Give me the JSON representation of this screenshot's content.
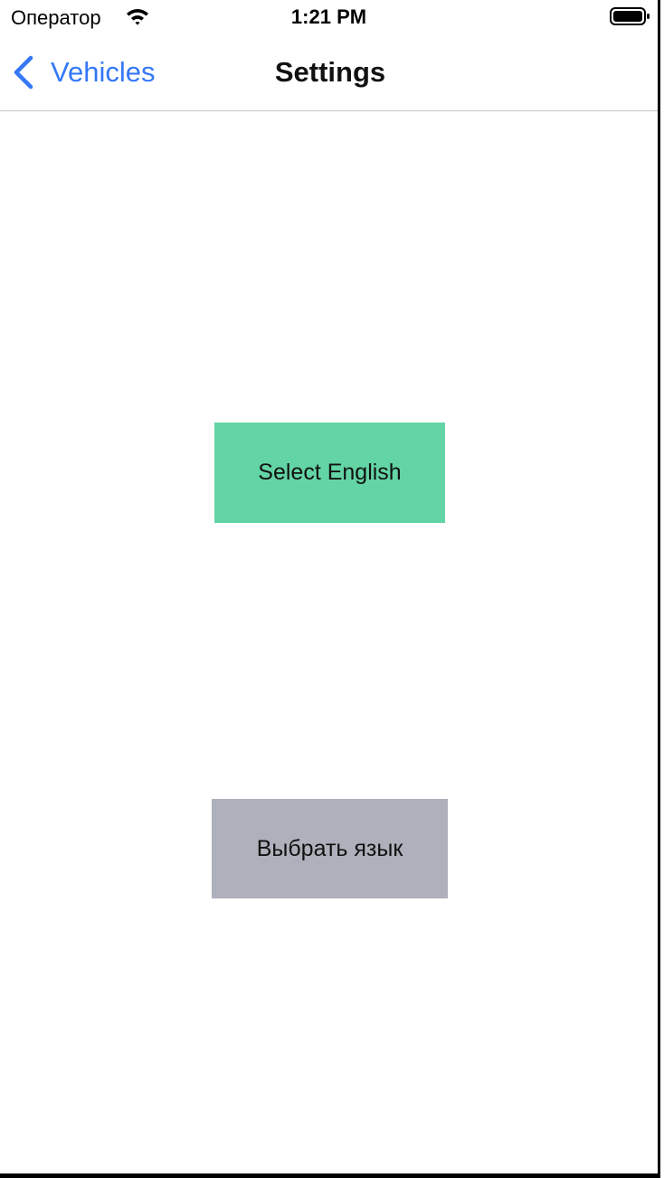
{
  "status_bar": {
    "carrier": "Оператор",
    "time": "1:21 PM",
    "wifi_icon": "wifi-icon",
    "battery_icon": "battery-full-icon"
  },
  "nav_bar": {
    "back_label": "Vehicles",
    "back_icon": "chevron-left-icon",
    "title": "Settings",
    "accent_color": "#3478f6"
  },
  "main": {
    "english_button": {
      "label": "Select English",
      "color": "#63d4a4"
    },
    "russian_button": {
      "label": "Выбрать язык",
      "color": "#aeb0bb"
    }
  }
}
